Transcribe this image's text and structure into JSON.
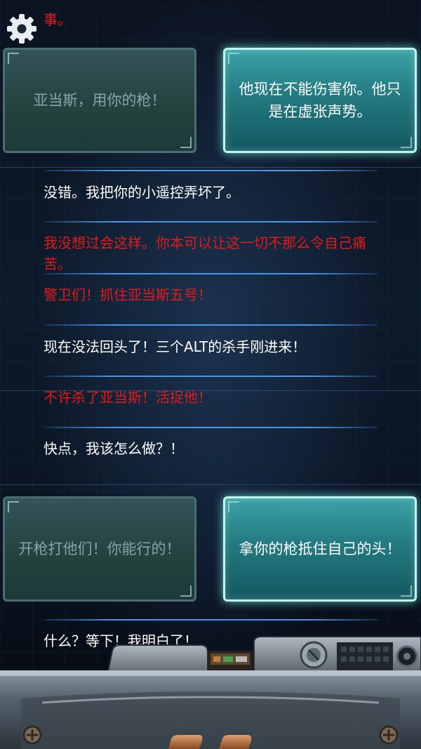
{
  "header": {
    "overflow_text": "事。"
  },
  "settings": {
    "icon": "gear-icon"
  },
  "choices_top": {
    "left": "亚当斯，用你的枪！",
    "right": "他现在不能伤害你。他只是在虚张声势。"
  },
  "dialogue": [
    {
      "text": "没错。我把你的小遥控弄坏了。",
      "color": "white"
    },
    {
      "text": "我没想过会这样。你本可以让这一切不那么令自己痛苦。",
      "color": "red"
    },
    {
      "text": "警卫们！抓住亚当斯五号！",
      "color": "red"
    },
    {
      "text": "现在没法回头了！三个ALT的杀手刚进来！",
      "color": "white"
    },
    {
      "text": "不许杀了亚当斯！活捉他！",
      "color": "red"
    },
    {
      "text": "快点，我该怎么做？！",
      "color": "white"
    }
  ],
  "choices_bottom": {
    "left": "开枪打他们！你能行的！",
    "right": "拿你的枪抵住自己的头！"
  },
  "last_line": "什么？等下！我明白了！",
  "colors": {
    "red": "#e21a1a",
    "white": "#ffffff",
    "accent_cyan": "#bff7f3",
    "separator_blue": "#50a0ff"
  }
}
